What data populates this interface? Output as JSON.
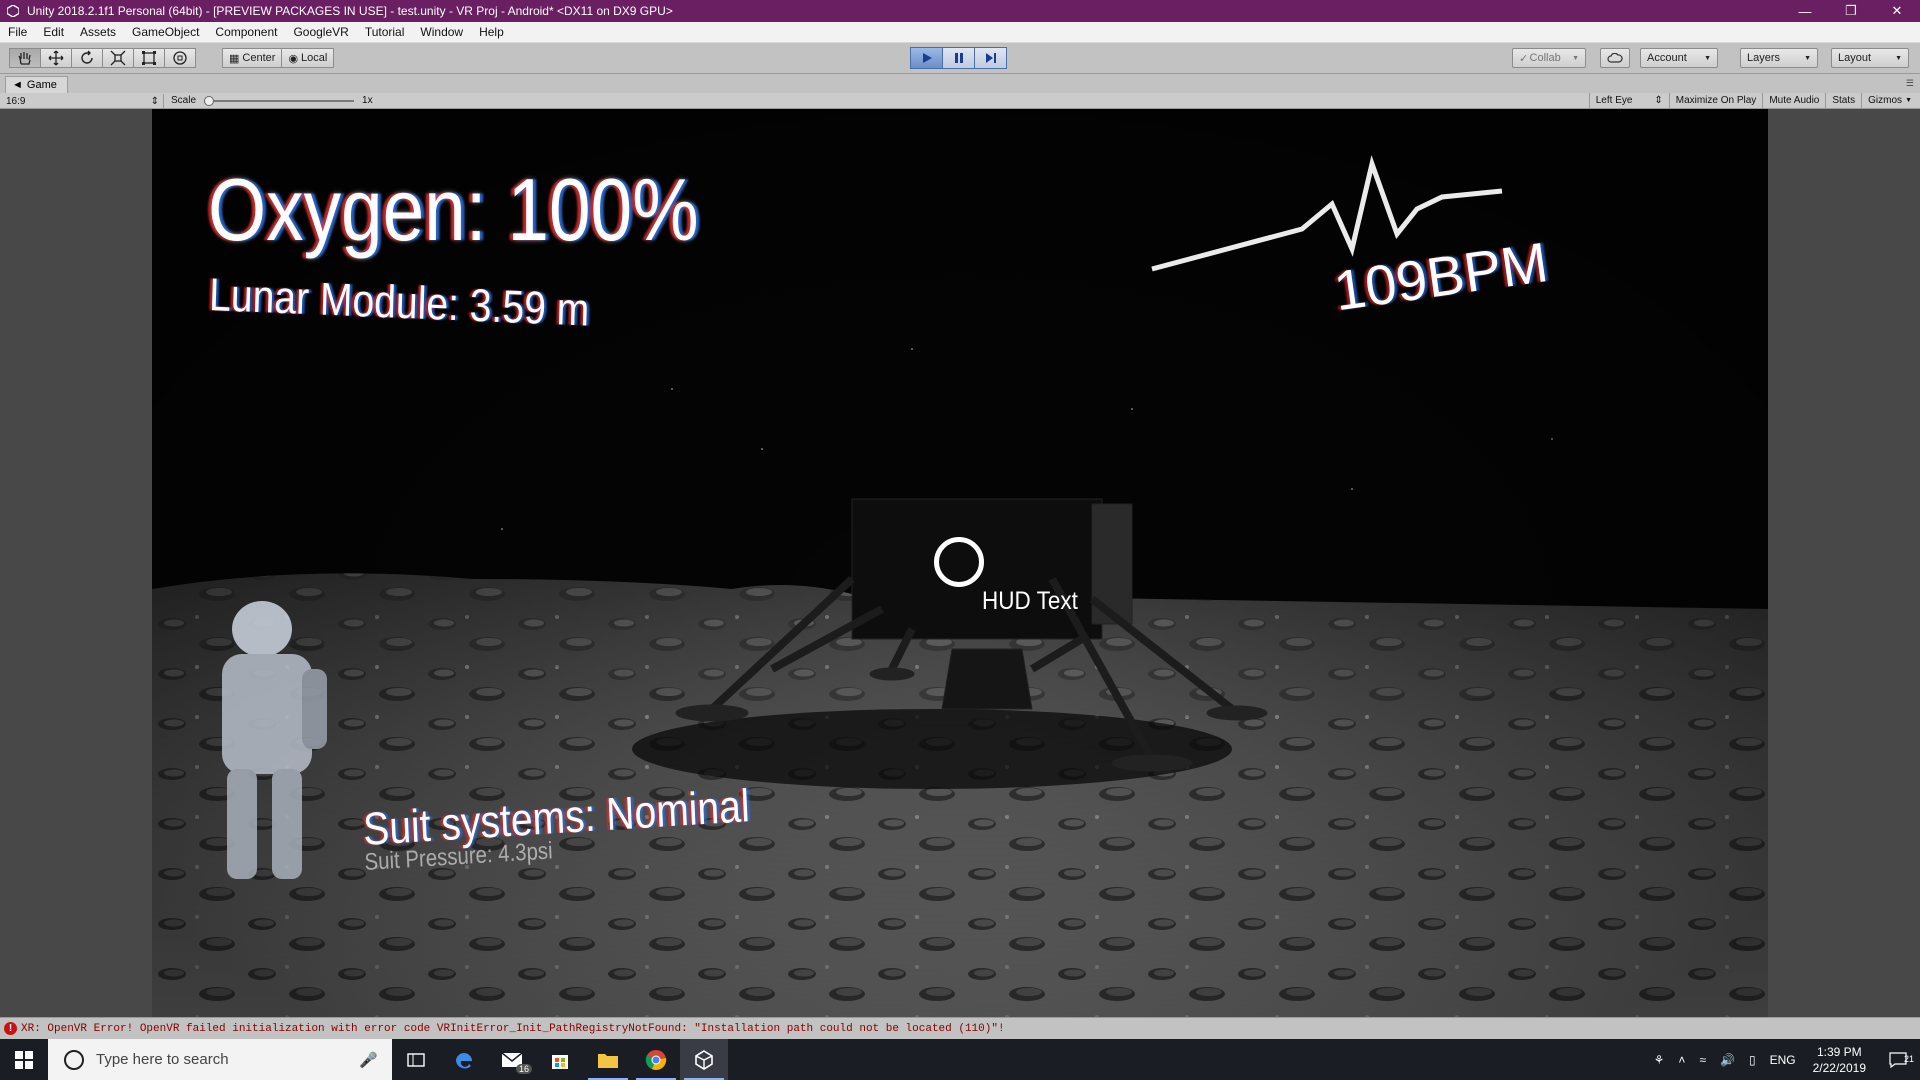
{
  "window": {
    "title": "Unity 2018.2.1f1 Personal (64bit) - [PREVIEW PACKAGES IN USE] - test.unity - VR Proj - Android* <DX11 on DX9 GPU>",
    "controls": [
      "minimize-icon",
      "restore-icon",
      "close-icon"
    ]
  },
  "menu": [
    "File",
    "Edit",
    "Assets",
    "GameObject",
    "Component",
    "GoogleVR",
    "Tutorial",
    "Window",
    "Help"
  ],
  "toolbar": {
    "tools": [
      "hand-tool-icon",
      "move-tool-icon",
      "rotate-tool-icon",
      "scale-tool-icon",
      "rect-tool-icon",
      "transform-tool-icon"
    ],
    "pivot_center": "Center",
    "pivot_local": "Local",
    "play_state": "playing",
    "collab": "Collab",
    "account": "Account",
    "layers": "Layers",
    "layout": "Layout"
  },
  "game_tab": {
    "label": "Game",
    "aspect": "16:9",
    "scale_label": "Scale",
    "scale_value": "1x",
    "eye": "Left Eye",
    "options": [
      "Maximize On Play",
      "Mute Audio",
      "Stats",
      "Gizmos"
    ]
  },
  "hud": {
    "oxygen": "Oxygen: 100%",
    "lunar_module": "Lunar Module: 3.59 m",
    "bpm": "109BPM",
    "hud_text": "HUD Text",
    "suit_systems": "Suit systems: Nominal",
    "suit_pressure": "Suit Pressure: 4.3psi"
  },
  "console": {
    "message": "XR: OpenVR Error! OpenVR failed initialization with error code VRInitError_Init_PathRegistryNotFound: \"Installation path could not be located (110)\"!"
  },
  "taskbar": {
    "search_placeholder": "Type here to search",
    "apps": [
      "task-view-icon",
      "edge-icon",
      "mail-icon",
      "store-icon",
      "file-explorer-icon",
      "chrome-icon",
      "unity-icon"
    ],
    "mail_badge": "16",
    "language": "ENG",
    "time": "1:39 PM",
    "date": "2/22/2019",
    "notifications": "21"
  },
  "colors": {
    "titlebar": "#6b1f63",
    "editor_gray": "#c2c2c2",
    "play_active": "#6c8fc8",
    "taskbar": "#1b1d24"
  }
}
